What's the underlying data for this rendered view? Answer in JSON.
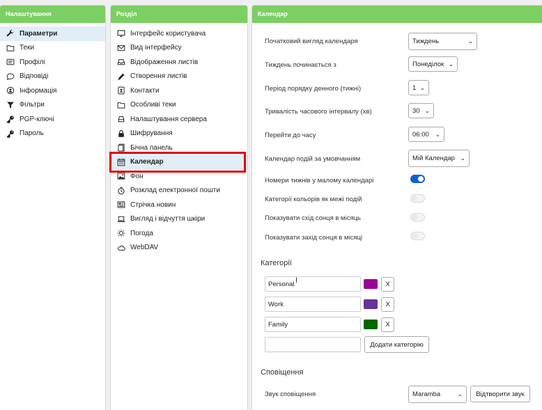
{
  "settings_panel": {
    "title": "Налаштування",
    "items": [
      {
        "label": "Параметри",
        "icon": "wrench-icon",
        "active": true
      },
      {
        "label": "Теки",
        "icon": "folder-icon"
      },
      {
        "label": "Профілі",
        "icon": "id-card-icon"
      },
      {
        "label": "Відповіді",
        "icon": "speech-bubble-icon"
      },
      {
        "label": "Інформація",
        "icon": "user-info-icon"
      },
      {
        "label": "Фільтри",
        "icon": "filter-icon"
      },
      {
        "label": "PGP-ключі",
        "icon": "key-icon"
      },
      {
        "label": "Пароль",
        "icon": "key-icon"
      }
    ]
  },
  "sections_panel": {
    "title": "Розділ",
    "items": [
      {
        "label": "Інтерфейс користувача",
        "icon": "monitor-icon"
      },
      {
        "label": "Вид інтерфейсу",
        "icon": "envelope-icon"
      },
      {
        "label": "Відображення листів",
        "icon": "inbox-icon"
      },
      {
        "label": "Створення листів",
        "icon": "pencil-icon"
      },
      {
        "label": "Контакти",
        "icon": "contact-card-icon"
      },
      {
        "label": "Особливі теки",
        "icon": "folder-icon"
      },
      {
        "label": "Налаштування сервера",
        "icon": "server-icon"
      },
      {
        "label": "Шифрування",
        "icon": "lock-icon"
      },
      {
        "label": "Бічна панель",
        "icon": "sidebar-icon"
      },
      {
        "label": "Календар",
        "icon": "calendar-icon",
        "active": true
      },
      {
        "label": "Фон",
        "icon": "image-icon"
      },
      {
        "label": "Розклад електронної пошти",
        "icon": "clock-icon"
      },
      {
        "label": "Стрічка новин",
        "icon": "newspaper-icon"
      },
      {
        "label": "Вигляд і відчуття шкіри",
        "icon": "laptop-icon"
      },
      {
        "label": "Погода",
        "icon": "sun-icon"
      },
      {
        "label": "WebDAV",
        "icon": "cloud-icon"
      }
    ]
  },
  "calendar_panel": {
    "title": "Календар",
    "settings": [
      {
        "label": "Початковий вигляд календаря",
        "type": "select",
        "value": "Тиждень"
      },
      {
        "label": "Тиждень починається з",
        "type": "select",
        "value": "Понеділок"
      },
      {
        "label": "Період порядку денного (тижні)",
        "type": "select",
        "value": "1"
      },
      {
        "label": "Тривалість часового інтервалу (хв)",
        "type": "select",
        "value": "30"
      },
      {
        "label": "Перейти до часу",
        "type": "select",
        "value": "06:00"
      },
      {
        "label": "Календар подій за умовчанням",
        "type": "select",
        "value": "Мій Календар"
      },
      {
        "label": "Номери тижнів у малому календарі",
        "type": "toggle",
        "on": true
      },
      {
        "label": "Категорії кольорів як межі подій",
        "type": "toggle",
        "on": false
      },
      {
        "label": "Показувати схід сонця в місяць",
        "type": "toggle",
        "on": false
      },
      {
        "label": "Показувати захід сонця в місяці",
        "type": "toggle",
        "on": false
      }
    ],
    "categories_title": "Категорії",
    "categories": [
      {
        "name": "Personal",
        "color": "#990099"
      },
      {
        "name": "Work",
        "color": "#663399"
      },
      {
        "name": "Family",
        "color": "#006600"
      }
    ],
    "remove_label": "X",
    "new_category_placeholder": "",
    "add_category_label": "Додати категорію",
    "notifications_title": "Сповіщення",
    "sound_label": "Звук сповіщення",
    "sound_value": "Maramba",
    "play_sound_label": "Відтворити звук"
  },
  "colors": {
    "header_green": "#7ccf62",
    "active_row": "#e1eef7",
    "highlight_red": "#e00000",
    "toggle_blue": "#0b63ce"
  }
}
